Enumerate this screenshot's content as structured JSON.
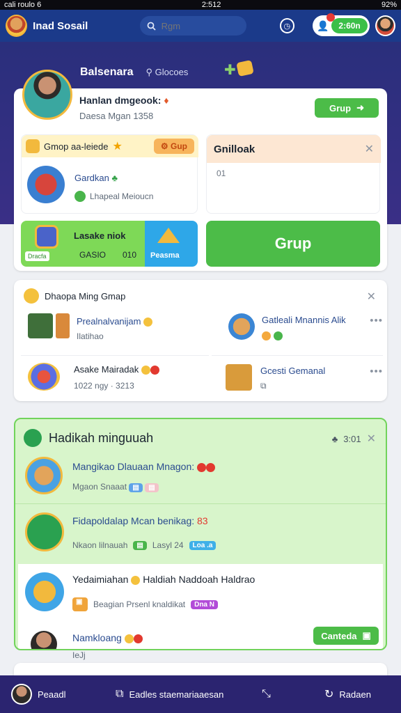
{
  "status_bar": {
    "carrier": "cali roulo 6",
    "time": "2:512",
    "battery": "92%"
  },
  "header": {
    "app_name": "Inad Sosail",
    "search_placeholder": "Rgm",
    "coin_value": "2:60n"
  },
  "profile": {
    "name": "Balsenara",
    "tag": "Glocoes",
    "title": "Hanlan dmgeook:",
    "subtitle": "Daesa Mgan 1358",
    "button_label": "Grup"
  },
  "group_card": {
    "title": "Gmop aa-leiede",
    "badge": "Gup",
    "item_name": "Gardkan",
    "item_sub": "Lhapeal Meioucn"
  },
  "promo_card": {
    "title": "Lasake niok",
    "label_left": "GASIO",
    "label_mid": "010",
    "label_right": "Peasma",
    "left_pill": "Dracfa"
  },
  "side_panel": {
    "title": "Gnilloak",
    "value": "01",
    "cta_label": "Grup"
  },
  "suggest_card": {
    "title": "Dhaopa Ming Gmap",
    "items": [
      {
        "name": "Prealnalvanijam",
        "sub": "Ilatihao"
      },
      {
        "name": "Gatleali Mnannis Alik",
        "sub": ""
      },
      {
        "name": "Asake Mairadak",
        "sub": "1022 ngy · 3213"
      },
      {
        "name": "Gcesti Gemanal",
        "sub": ""
      }
    ]
  },
  "gift_card": {
    "title": "Hadikah minguuah",
    "count": "3:01",
    "items": [
      {
        "name": "Mangikao Dlauaan Mnagon:",
        "sub": "Mgaon Snaaat"
      },
      {
        "name": "Fidapoldalap Mcan benikag:",
        "count": "83",
        "sub_a": "Nkaon lilnauah",
        "sub_b": "Lasyl 24",
        "pill": "Loa .a"
      },
      {
        "name": "Yedaimiahan",
        "name2": "Haldiah Naddoah Haldrao",
        "sub": "Beagian Prsenl knaldikat",
        "pill": "Dna N"
      },
      {
        "name": "Namkloang",
        "button": "Canteda"
      }
    ],
    "after_sub": "IeJj"
  },
  "bottom_nav": {
    "profile": "Peaadl",
    "center": "Eadles staemariaaesan",
    "right": "Radaen"
  }
}
